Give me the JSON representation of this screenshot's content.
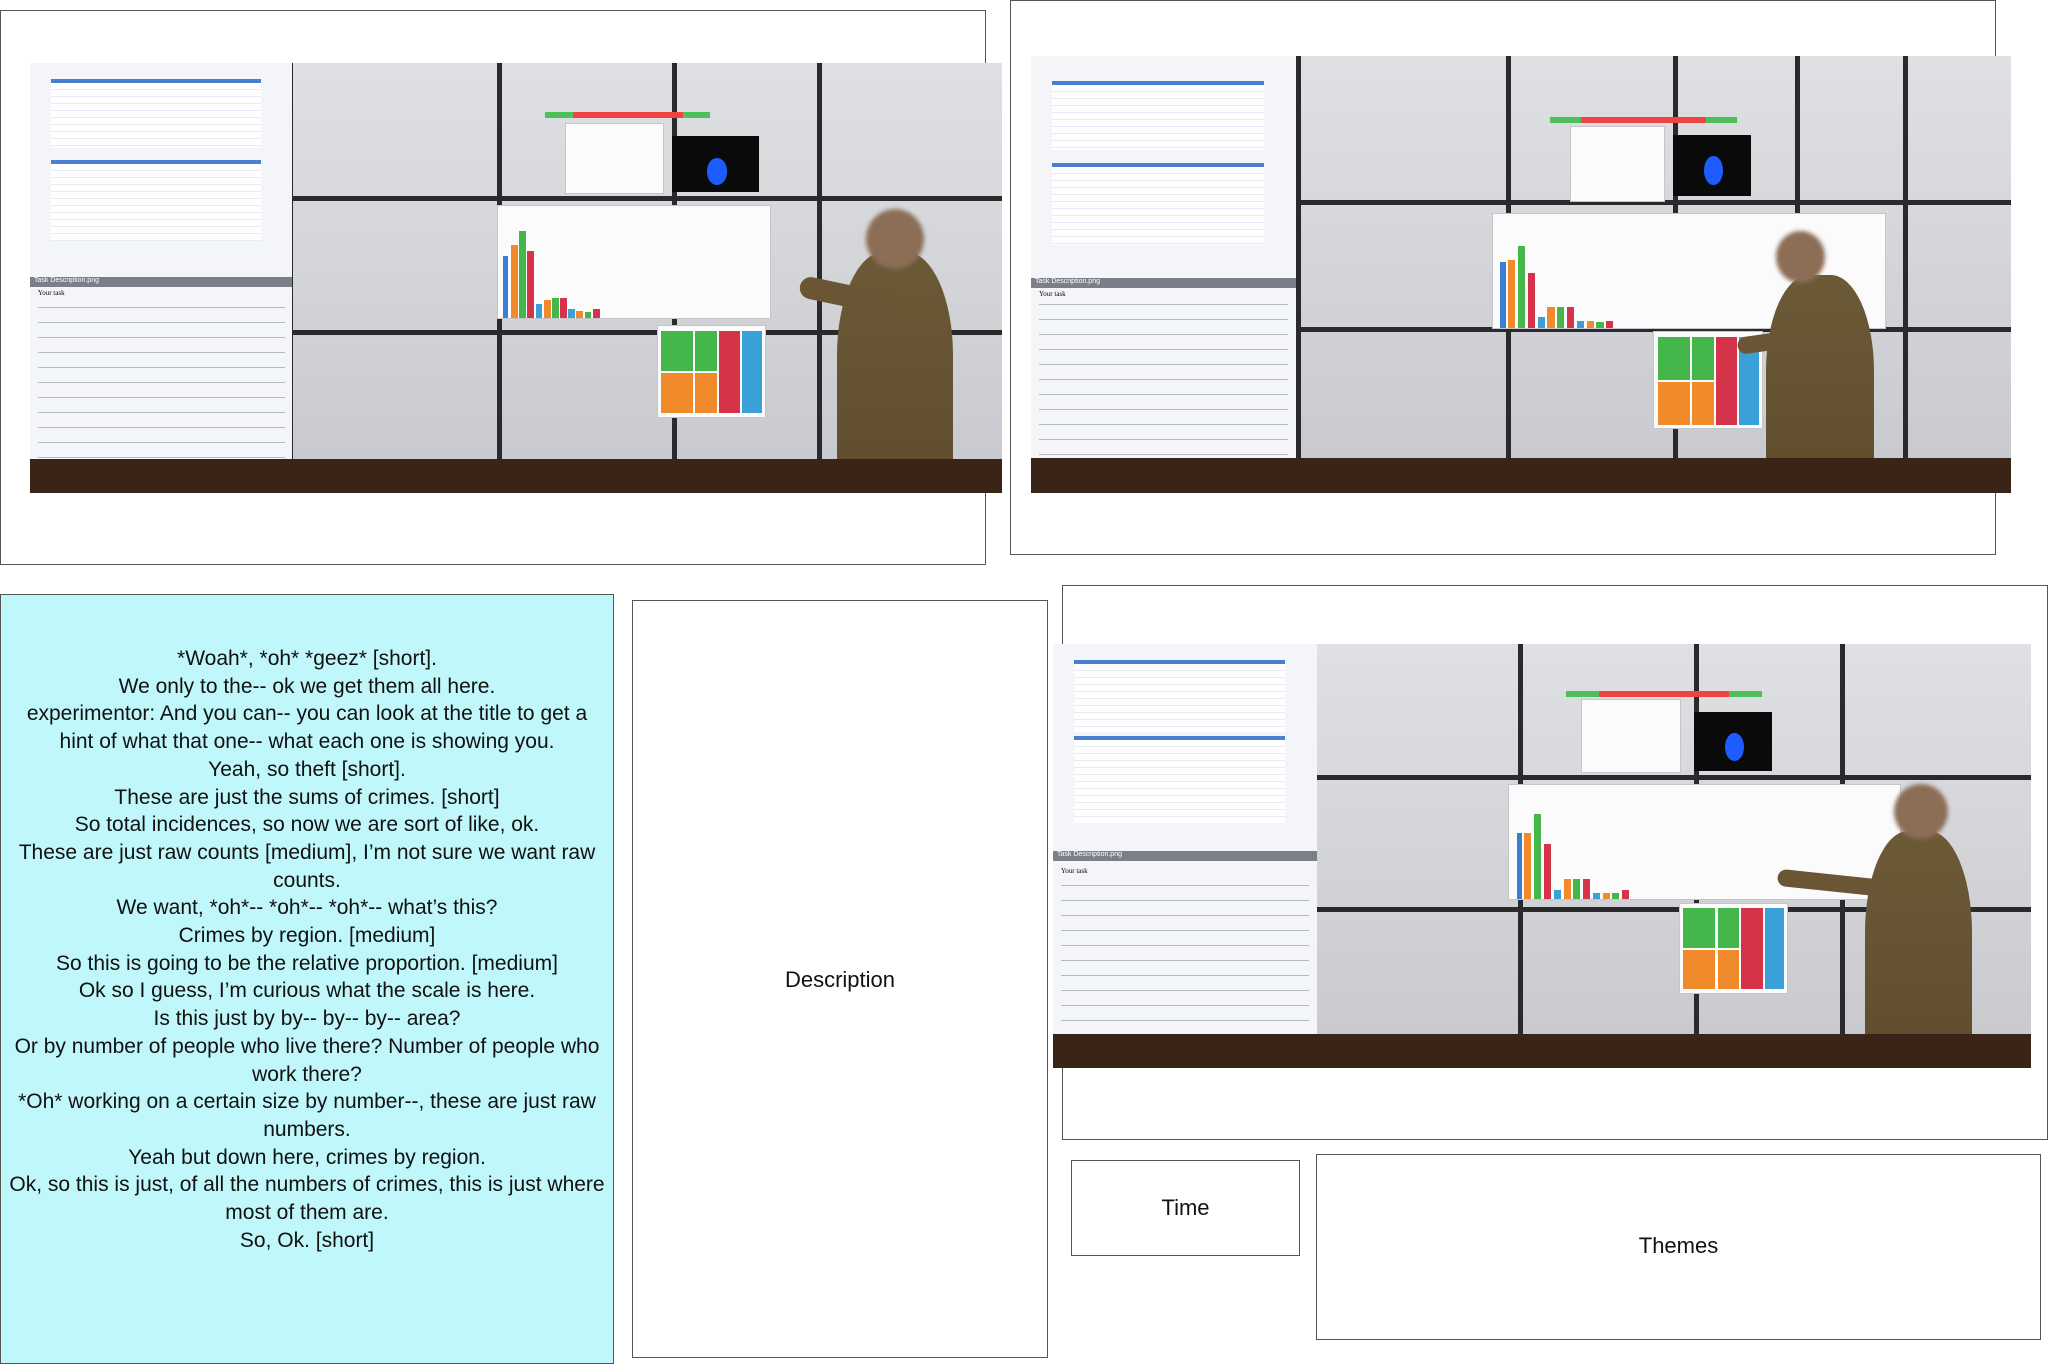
{
  "transcript": {
    "lines": [
      "*Woah*, *oh* *geez* [short].",
      "We only to the-- ok we get them all here.",
      "experimentor: And you can-- you can look at the title to get a hint of what that one-- what each one is showing you.",
      "Yeah, so theft [short].",
      "These are just the sums of crimes. [short]",
      "So total incidences, so now we are sort of like, ok.",
      "These are just raw counts [medium], I’m not sure we want raw counts.",
      "We want, *oh*-- *oh*-- *oh*-- what’s this?",
      "Crimes by region. [medium]",
      "So this is going to be the relative proportion. [medium]",
      "Ok so I guess, I’m curious what the scale is here.",
      "Is this just by by-- by-- by-- area?",
      "Or by number of people who live there? Number of people who work there?",
      "*Oh* working on a certain size by number--, these are just raw numbers.",
      "Yeah but down here, crimes by region.",
      "Ok, so this is just, of all the numbers of crimes, this is just where most of them are.",
      "So, Ok. [short]"
    ]
  },
  "description": {
    "label": "Description"
  },
  "time": {
    "label": "Time"
  },
  "themes": {
    "label": "Themes"
  },
  "photos": [
    {
      "doc_title": "Task Description.png",
      "doc_heading": "Your task"
    },
    {
      "doc_title": "Task Description.png",
      "doc_heading": "Your task"
    },
    {
      "doc_title": "Task Description.png",
      "doc_heading": "Your task"
    }
  ],
  "colors": {
    "transcript_bg": "#bff7fa",
    "bar_blue": "#3a7fd5",
    "bar_orange": "#f08a2a",
    "bar_green": "#45b649",
    "bar_red": "#d4334a",
    "bar_cyan": "#3aa0d8"
  }
}
